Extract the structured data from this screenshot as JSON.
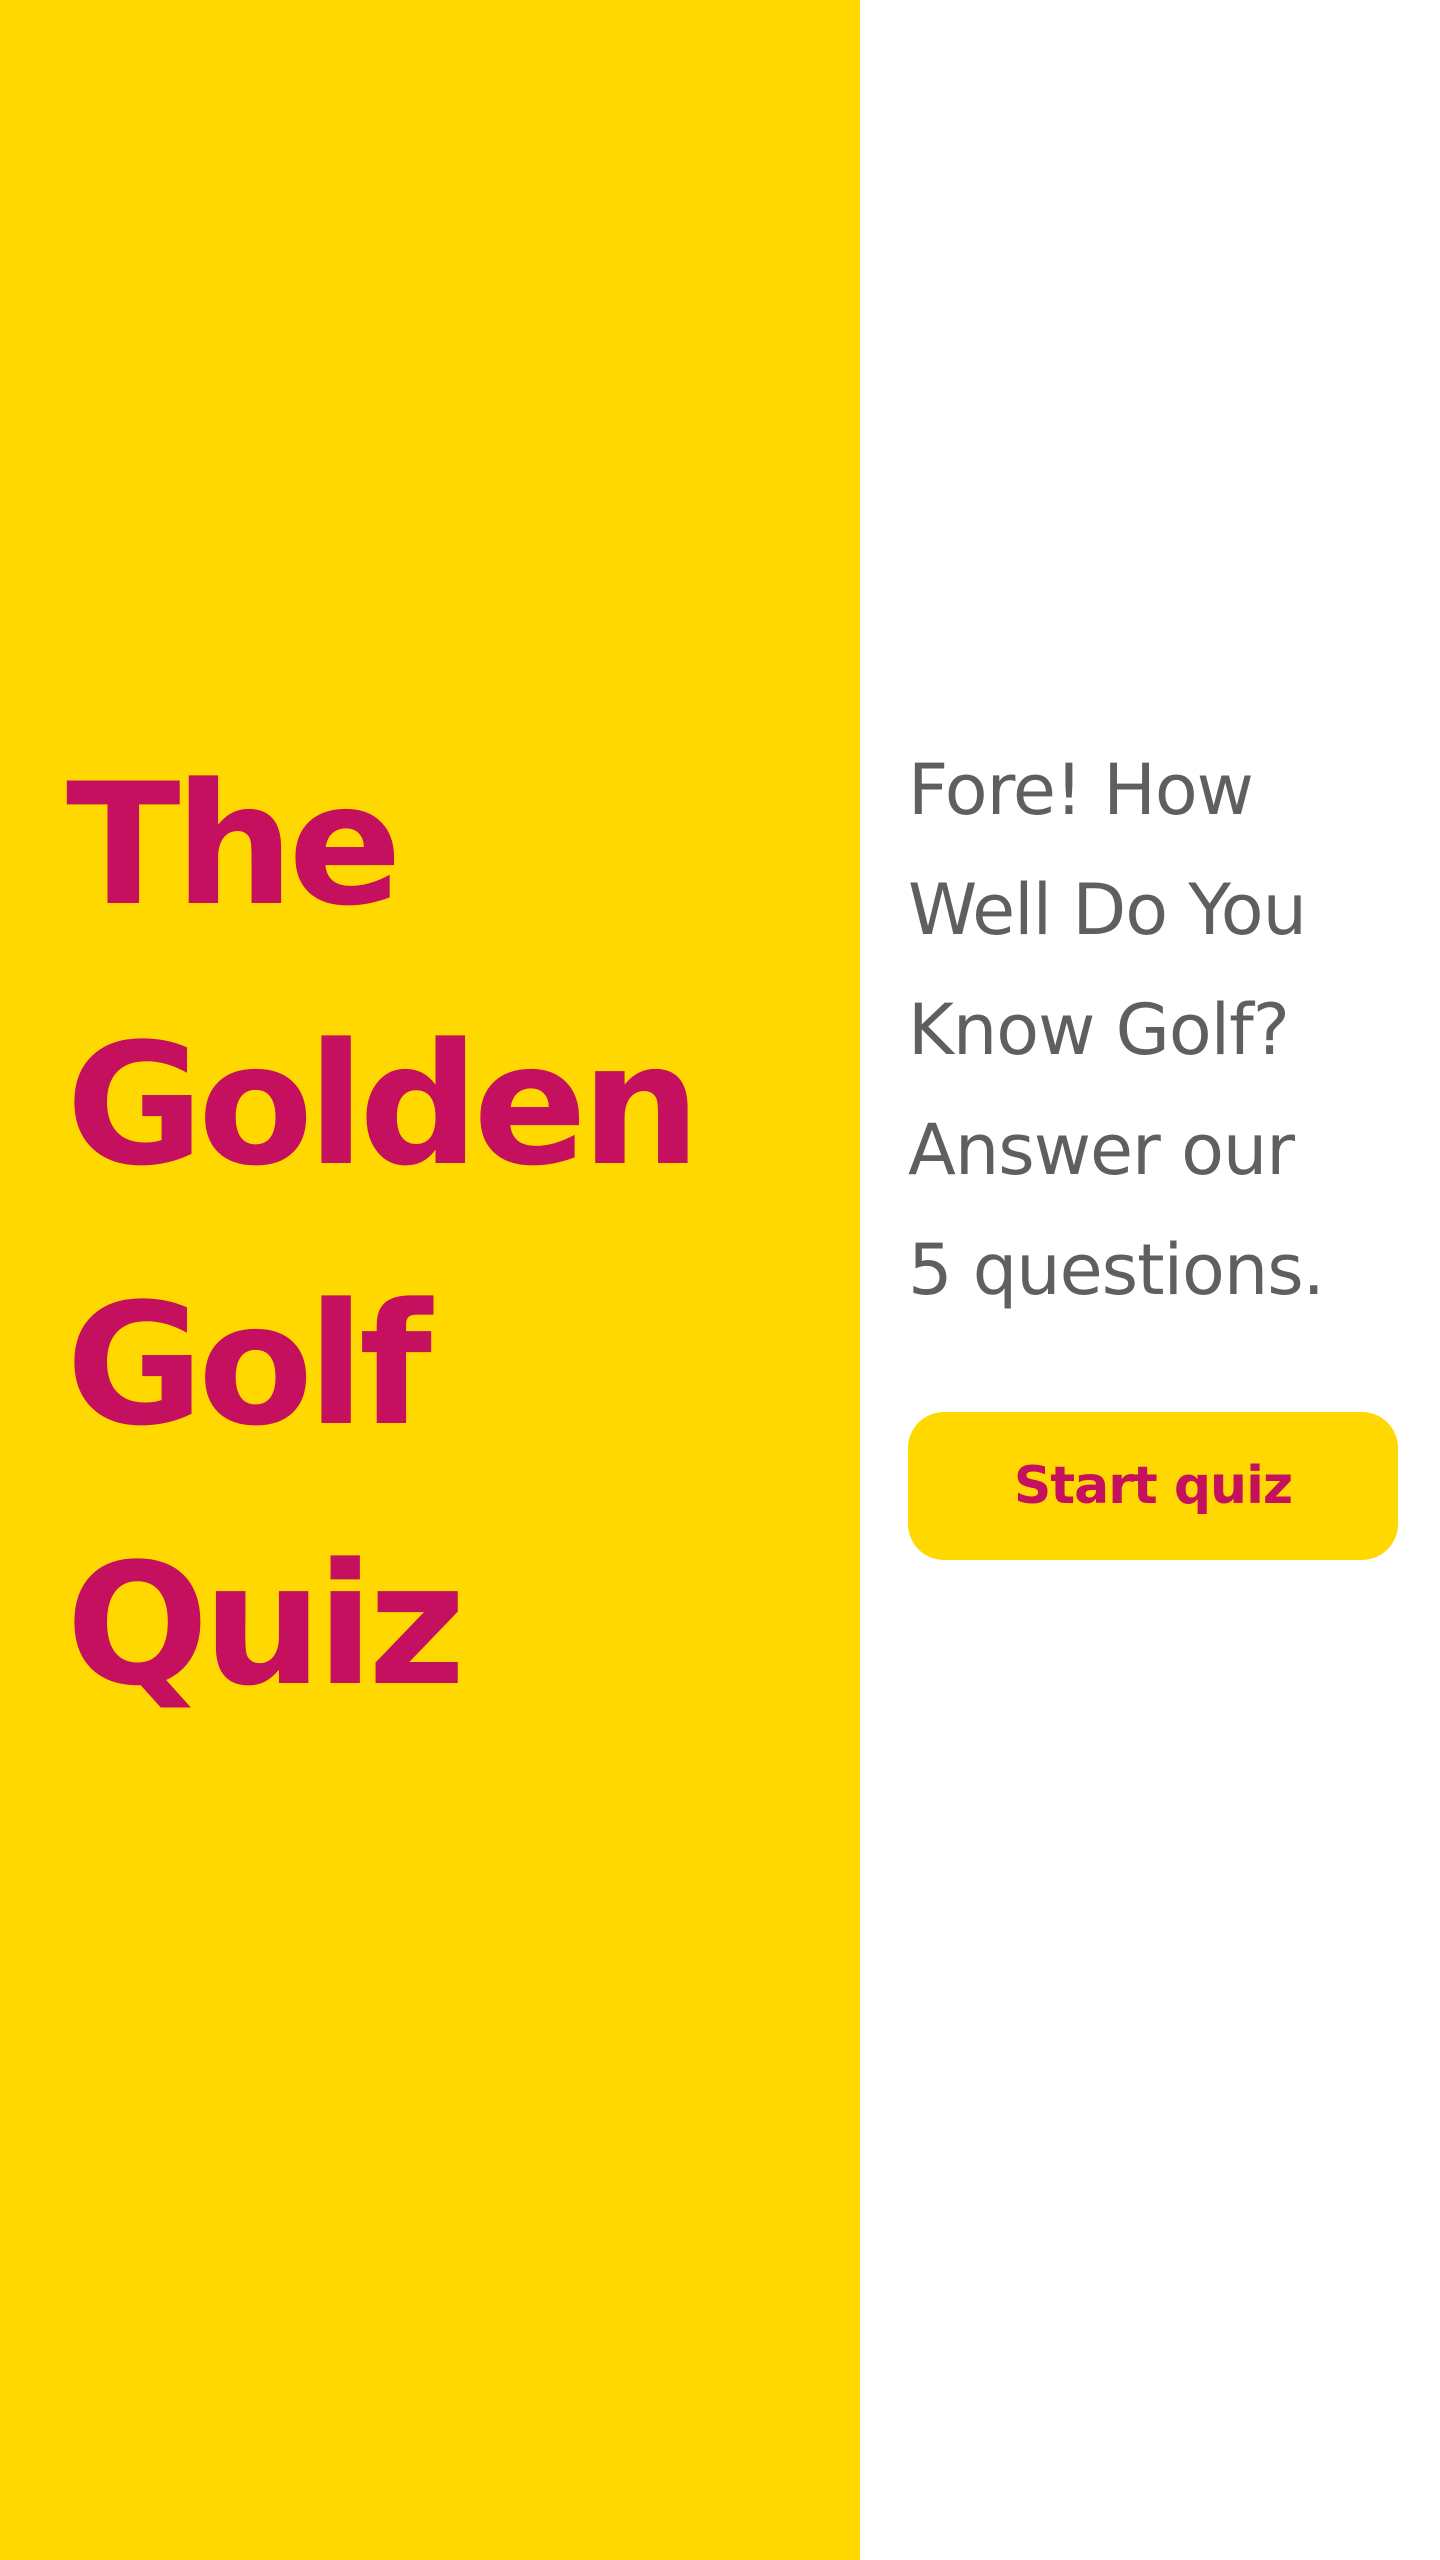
{
  "hero": {
    "title_lines": [
      "The",
      "Golden",
      "Golf",
      "Quiz"
    ]
  },
  "intro": {
    "text_lines": [
      "Fore! How",
      "Well Do You",
      "Know Golf?",
      "Answer our",
      "5 questions."
    ]
  },
  "cta": {
    "label": "Start quiz"
  },
  "colors": {
    "accent_yellow": "#FFD800",
    "brand_magenta": "#C4105E",
    "body_text_gray": "#5F5F5F",
    "background_white": "#FFFFFF"
  }
}
